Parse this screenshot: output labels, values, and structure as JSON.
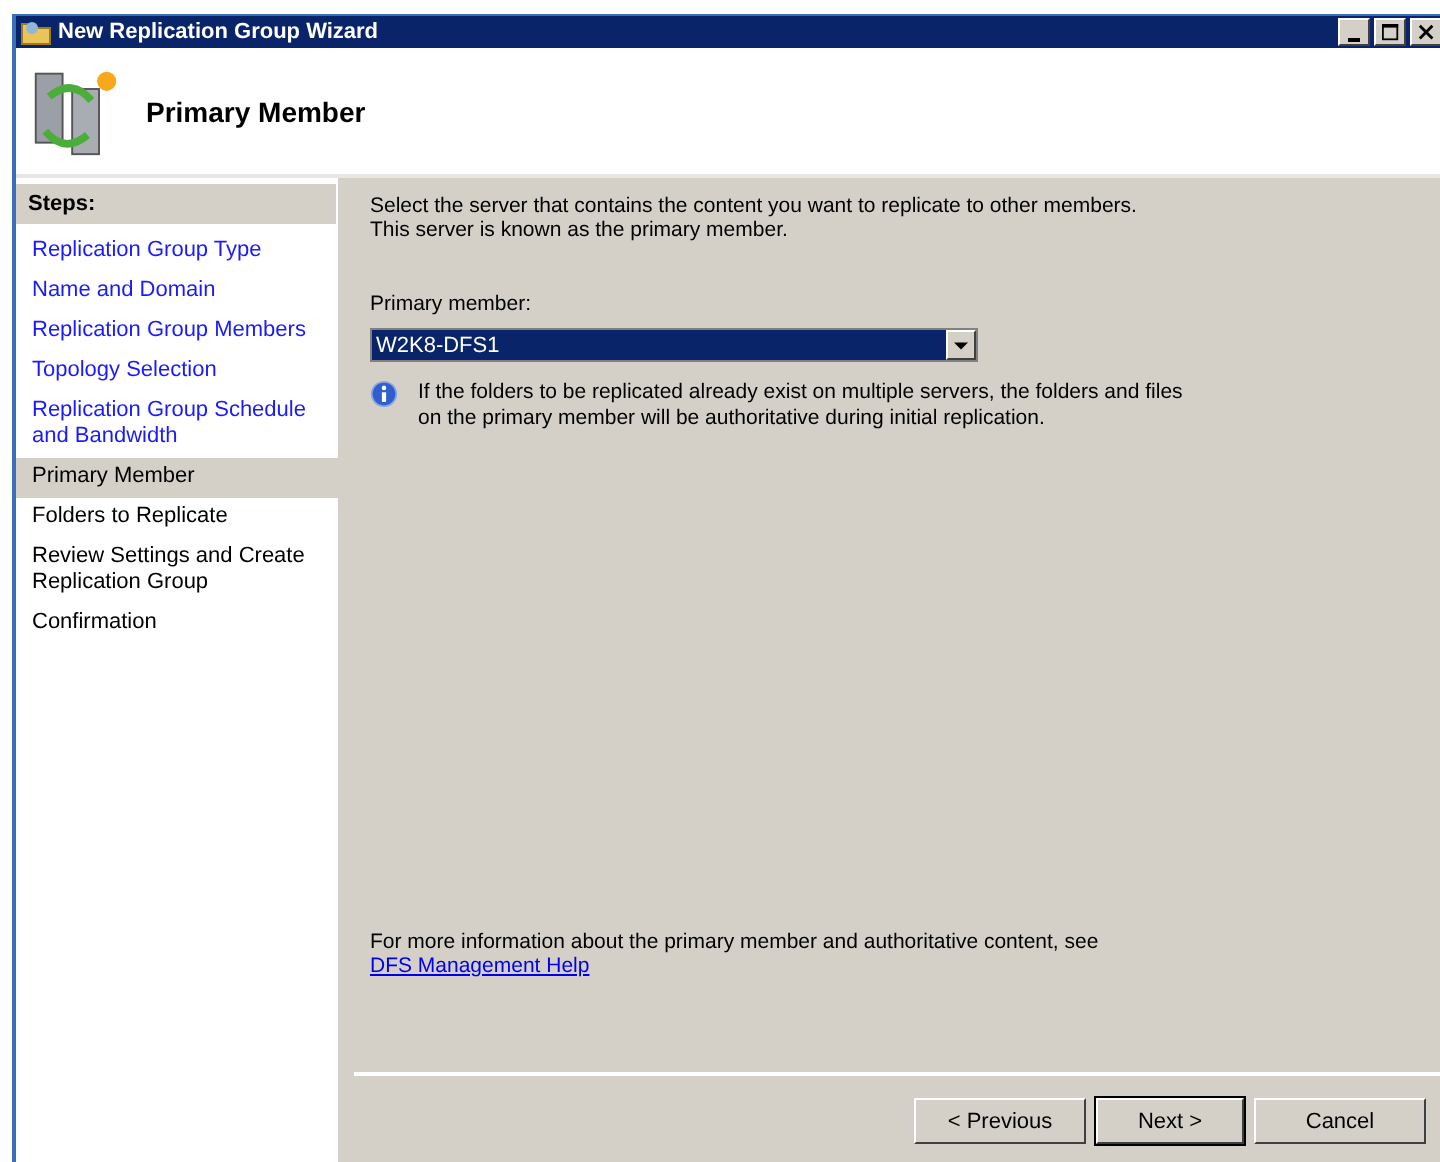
{
  "window": {
    "title": "New Replication Group Wizard"
  },
  "header": {
    "title": "Primary Member"
  },
  "steps": {
    "heading": "Steps:",
    "items": [
      {
        "label": "Replication Group Type",
        "completed": true,
        "selected": false
      },
      {
        "label": "Name and Domain",
        "completed": true,
        "selected": false
      },
      {
        "label": "Replication Group Members",
        "completed": true,
        "selected": false
      },
      {
        "label": "Topology Selection",
        "completed": true,
        "selected": false
      },
      {
        "label": "Replication Group Schedule and Bandwidth",
        "completed": true,
        "selected": false
      },
      {
        "label": "Primary Member",
        "completed": false,
        "selected": true
      },
      {
        "label": "Folders to Replicate",
        "completed": false,
        "selected": false
      },
      {
        "label": "Review Settings and Create Replication Group",
        "completed": false,
        "selected": false
      },
      {
        "label": "Confirmation",
        "completed": false,
        "selected": false
      }
    ]
  },
  "content": {
    "intro": [
      "Select the server that contains the content you want to replicate to other members.",
      "This server is known as the primary member."
    ],
    "field_label": "Primary member:",
    "field_value": "W2K8-DFS1",
    "info": "If the folders to be replicated already exist on multiple servers, the folders and files on the primary member will be authoritative during initial replication.",
    "more_info": "For more information about the primary member and authoritative content, see",
    "help_link": "DFS Management Help"
  },
  "buttons": [
    {
      "label": "< Previous",
      "default": false
    },
    {
      "label": "Next >",
      "default": true
    },
    {
      "label": "Cancel",
      "default": false
    }
  ]
}
